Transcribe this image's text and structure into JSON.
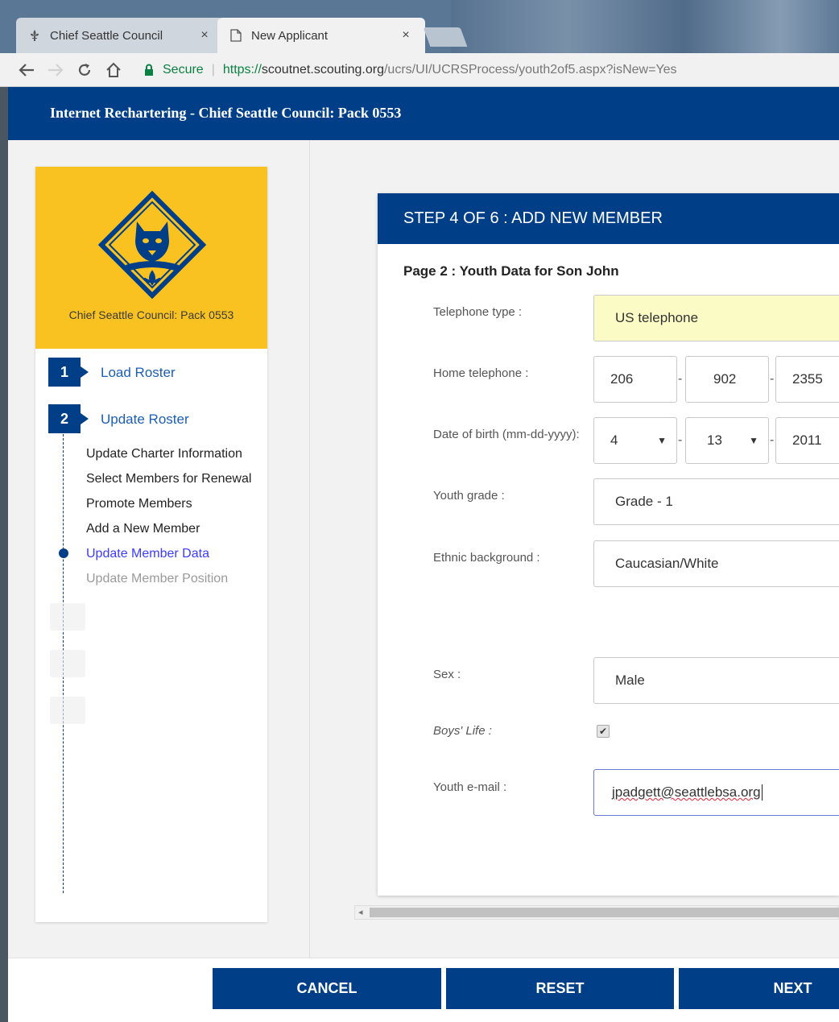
{
  "browser": {
    "tabs": [
      {
        "title": "Chief Seattle Council",
        "close": "×"
      },
      {
        "title": "New Applicant",
        "close": "×"
      }
    ],
    "omnibox": {
      "secure_label": "Secure",
      "url_scheme": "https://",
      "url_host": "scoutnet.scouting.org",
      "url_path": "/ucrs/UI/UCRSProcess/youth2of5.aspx?isNew=Yes"
    }
  },
  "header": {
    "title": "Internet Rechartering - Chief Seattle Council: Pack 0553"
  },
  "sidebar": {
    "unit_name": "Chief Seattle Council: Pack 0553",
    "steps": [
      {
        "number": "1",
        "label": "Load Roster"
      },
      {
        "number": "2",
        "label": "Update Roster"
      }
    ],
    "sub_items": [
      "Update Charter Information",
      "Select Members for Renewal",
      "Promote Members",
      "Add a New Member",
      "Update Member Data",
      "Update Member Position"
    ]
  },
  "form": {
    "title": "STEP 4 OF 6 : ADD NEW MEMBER",
    "subtitle": "Page 2 : Youth Data for Son John",
    "labels": {
      "telephone_type": "Telephone type :",
      "home_telephone": "Home telephone :",
      "dob": "Date of birth (mm-dd-yyyy):",
      "grade": "Youth grade :",
      "ethnic": "Ethnic background :",
      "sex": "Sex :",
      "boys_life": "Boys' Life :",
      "email": "Youth e-mail :"
    },
    "values": {
      "telephone_type": "US telephone",
      "phone_area": "206",
      "phone_prefix": "902",
      "phone_line": "2355",
      "dob_month": "4",
      "dob_day": "13",
      "dob_year": "2011",
      "grade": "Grade - 1",
      "ethnic": "Caucasian/White",
      "sex": "Male",
      "boys_life_checked": true,
      "email": "jpadgett@seattlebsa.org"
    },
    "separator": "-"
  },
  "buttons": {
    "cancel": "CANCEL",
    "reset": "RESET",
    "next": "NEXT"
  },
  "colors": {
    "brand_blue": "#003f87",
    "sidebar_gold": "#f9c221",
    "highlight_yellow": "#fbfbc6",
    "active_link": "#3b3bff"
  }
}
